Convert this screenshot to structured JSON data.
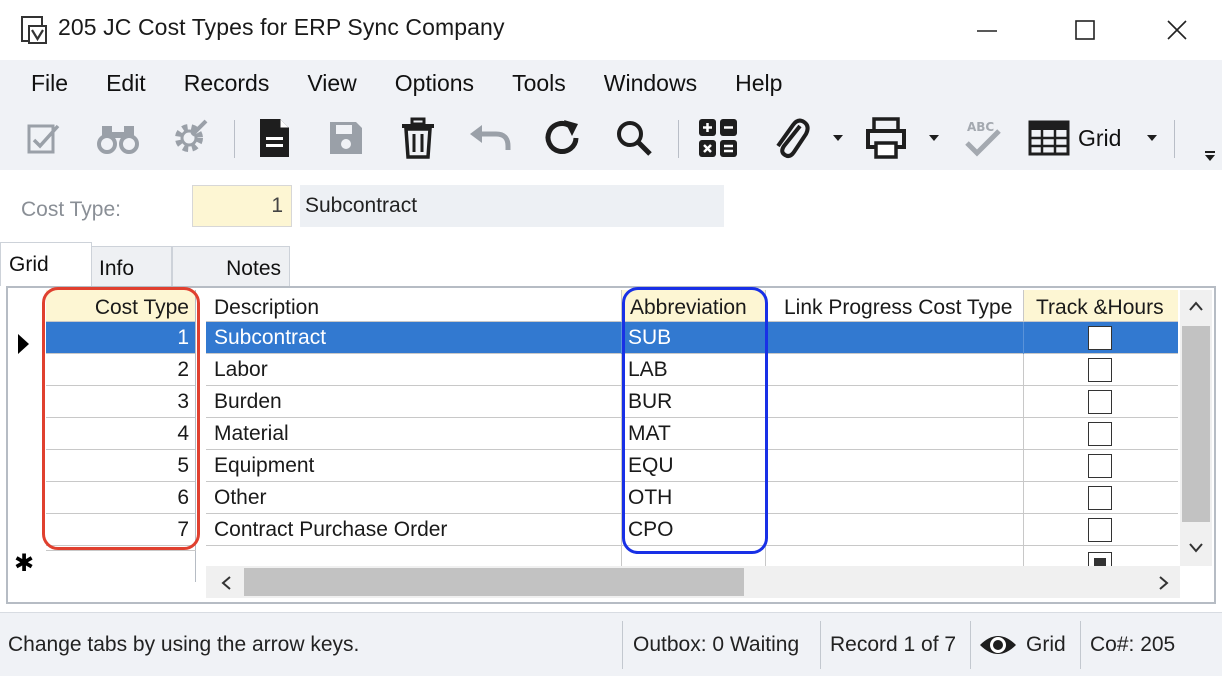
{
  "window": {
    "title": "205 JC Cost Types for ERP Sync Company",
    "minimize_icon": "minimize-icon",
    "maximize_icon": "maximize-icon",
    "close_icon": "close-icon"
  },
  "menu": [
    "File",
    "Edit",
    "Records",
    "View",
    "Options",
    "Tools",
    "Windows",
    "Help"
  ],
  "toolbar": {
    "view_mode_label": "Grid",
    "icons": [
      "edit-check-icon",
      "binoculars-icon",
      "settings-gear-icon",
      "new-document-icon",
      "save-icon",
      "delete-trash-icon",
      "undo-icon",
      "refresh-icon",
      "search-icon",
      "calculator-icon",
      "attachment-icon",
      "print-icon",
      "spellcheck-icon",
      "grid-icon"
    ]
  },
  "header": {
    "cost_type_label": "Cost Type:",
    "cost_type_value": "1",
    "cost_type_description": "Subcontract"
  },
  "tabs": [
    {
      "label": "Grid",
      "active": true
    },
    {
      "label": "Info",
      "active": false
    },
    {
      "label": "Notes",
      "active": false
    }
  ],
  "grid": {
    "cost_type_header": "Cost Type",
    "columns": [
      "Description",
      "Abbreviation",
      "Link Progress Cost Type",
      "Track &Hours"
    ],
    "rows": [
      {
        "cost_type": "1",
        "description": "Subcontract",
        "abbreviation": "SUB",
        "link": "",
        "track_hours": false,
        "selected": true
      },
      {
        "cost_type": "2",
        "description": "Labor",
        "abbreviation": "LAB",
        "link": "",
        "track_hours": false,
        "selected": false
      },
      {
        "cost_type": "3",
        "description": "Burden",
        "abbreviation": "BUR",
        "link": "",
        "track_hours": false,
        "selected": false
      },
      {
        "cost_type": "4",
        "description": "Material",
        "abbreviation": "MAT",
        "link": "",
        "track_hours": false,
        "selected": false
      },
      {
        "cost_type": "5",
        "description": "Equipment",
        "abbreviation": "EQU",
        "link": "",
        "track_hours": false,
        "selected": false
      },
      {
        "cost_type": "6",
        "description": "Other",
        "abbreviation": "OTH",
        "link": "",
        "track_hours": false,
        "selected": false
      },
      {
        "cost_type": "7",
        "description": "Contract Purchase Order",
        "abbreviation": "CPO",
        "link": "",
        "track_hours": false,
        "selected": false
      }
    ],
    "highlight_colors": {
      "cost_type_column": "#e0402f",
      "abbreviation_column": "#1830e6"
    }
  },
  "status": {
    "hint": "Change tabs by using the arrow keys.",
    "outbox": "Outbox: 0 Waiting",
    "record": "Record 1 of 7",
    "view": "Grid",
    "company": "Co#: 205"
  },
  "colors": {
    "selection": "#3279d0",
    "key_field": "#fdf6d3",
    "chrome": "#f0f2f6"
  }
}
